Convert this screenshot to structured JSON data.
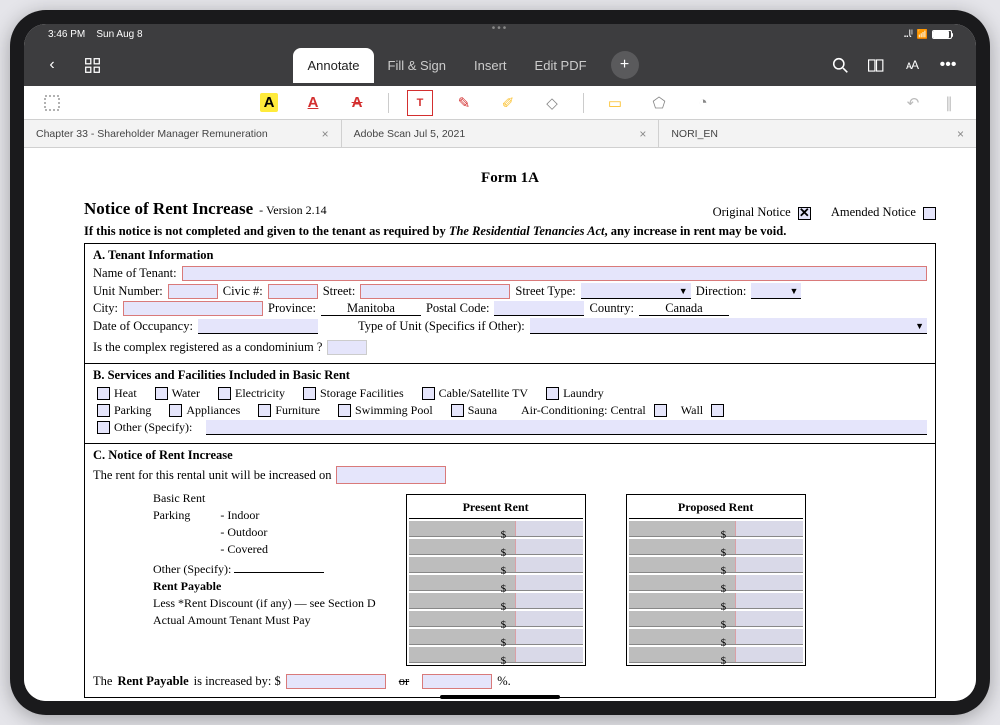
{
  "status": {
    "time": "3:46 PM",
    "date": "Sun Aug 8"
  },
  "modes": {
    "annotate": "Annotate",
    "fill": "Fill & Sign",
    "insert": "Insert",
    "edit": "Edit PDF"
  },
  "doc_tabs": {
    "t1": "Chapter 33 - Shareholder Manager Remuneration",
    "t2": "Adobe Scan Jul 5, 2021",
    "t3": "NORI_EN"
  },
  "form": {
    "title": "Form 1A",
    "header_main": "Notice of Rent Increase",
    "header_version": "- Version 2.14",
    "original": "Original Notice",
    "amended": "Amended Notice",
    "mandate_a": "If this notice is not completed and given to the tenant as required by ",
    "mandate_i": "The Residential Tenancies Act",
    "mandate_b": ", any increase in rent may be void.",
    "A": {
      "title": "A.  Tenant Information",
      "name": "Name of Tenant:",
      "unit": "Unit Number:",
      "civic": "Civic #:",
      "street": "Street:",
      "street_type": "Street Type:",
      "direction": "Direction:",
      "city": "City:",
      "province_lbl": "Province:",
      "province_val": "Manitoba",
      "postal": "Postal Code:",
      "country_lbl": "Country:",
      "country_val": "Canada",
      "occupancy": "Date of Occupancy:",
      "type_unit": "Type of Unit (Specifics if Other):",
      "condo": "Is the complex registered as a condominium ?"
    },
    "B": {
      "title": "B.  Services and Facilities Included in Basic Rent",
      "items": [
        "Heat",
        "Water",
        "Electricity",
        "Storage Facilities",
        "Cable/Satellite TV",
        "Laundry",
        "Parking",
        "Appliances",
        "Furniture",
        "Swimming Pool",
        "Sauna"
      ],
      "ac": "Air-Conditioning:  Central",
      "wall": "Wall",
      "other": "Other  (Specify):"
    },
    "C": {
      "title": "C.  Notice of Rent Increase",
      "intro": "The rent for this rental unit will be increased on",
      "present": "Present Rent",
      "proposed": "Proposed Rent",
      "basic": "Basic Rent",
      "parking": "Parking",
      "indoor": "-  Indoor",
      "outdoor": "-  Outdoor",
      "covered": "-  Covered",
      "other_spec": "Other (Specify):",
      "rent_payable": "Rent Payable",
      "less_discount": " Less *Rent Discount (if any) — see Section D",
      "actual": "Actual Amount Tenant Must Pay",
      "increased_a": "The ",
      "increased_b": "Rent Payable",
      "increased_c": " is increased by:   $",
      "or": "or",
      "pct": "%."
    }
  }
}
